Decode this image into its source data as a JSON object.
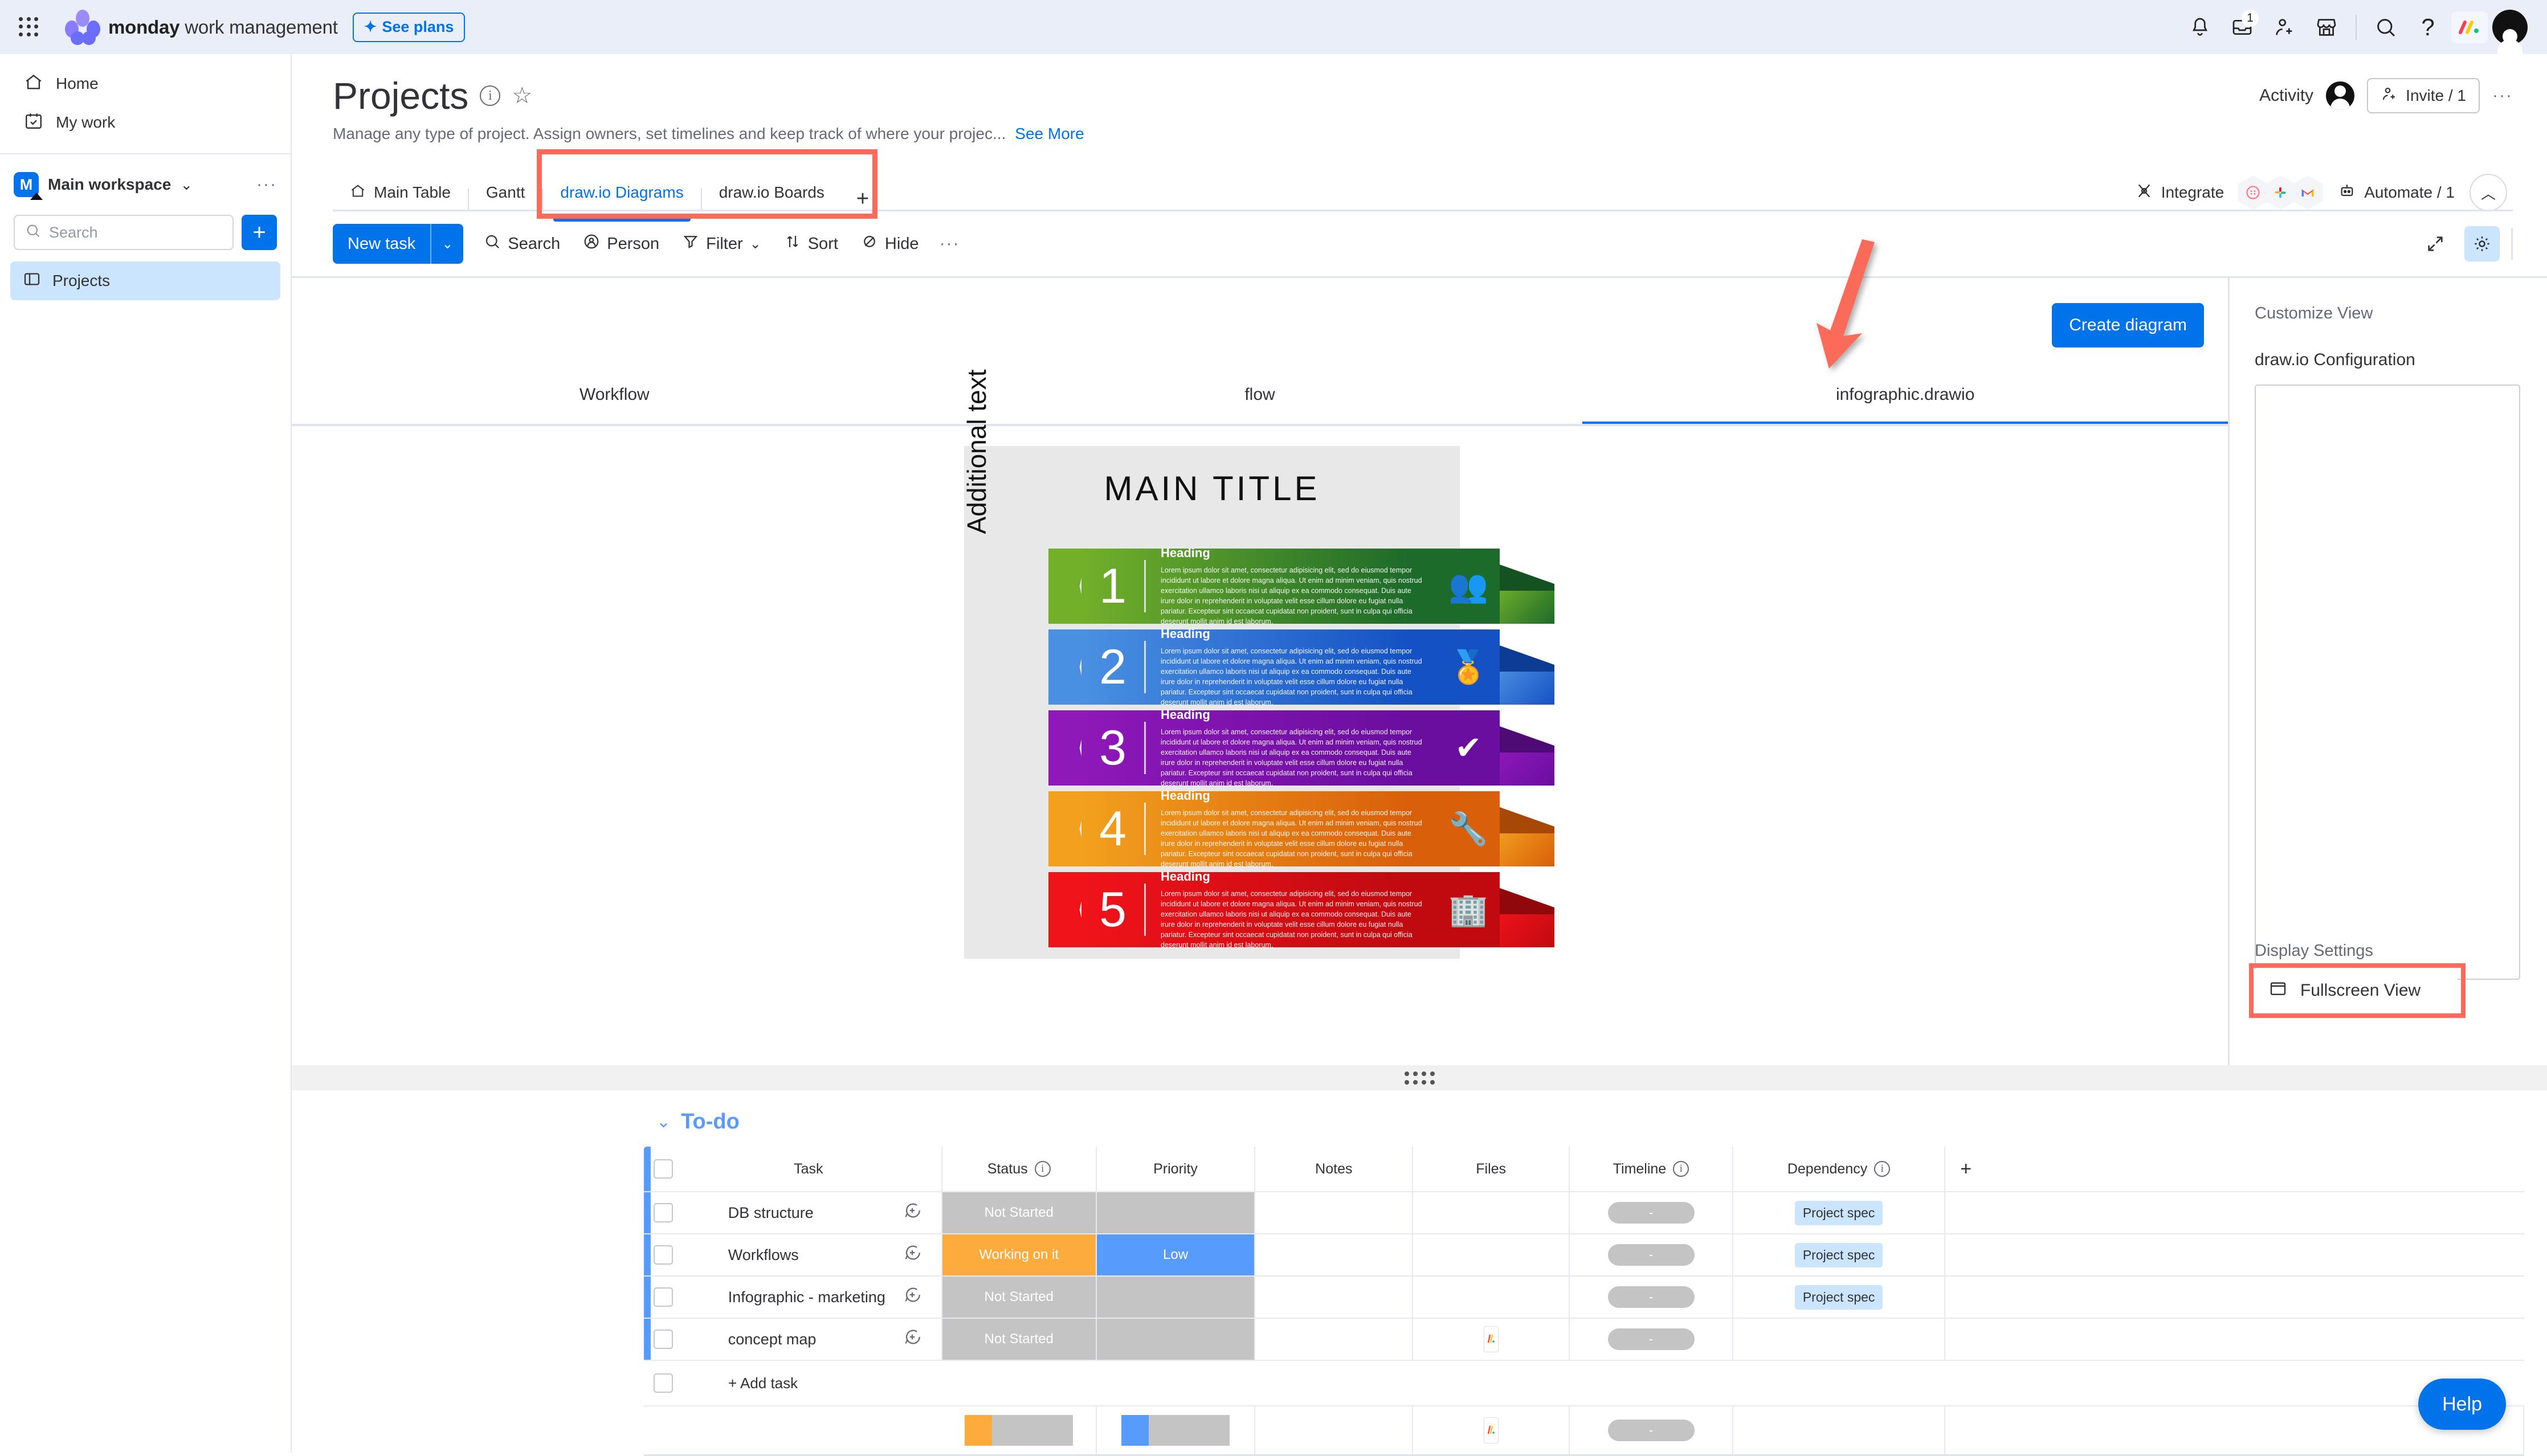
{
  "topbar": {
    "brand_bold": "monday",
    "brand_rest": " work management",
    "see_plans": "See plans",
    "icons": {
      "apps": "apps-grid-icon",
      "notifications": "bell-icon",
      "inbox": "inbox-icon",
      "inbox_badge": "1",
      "invite": "invite-person-icon",
      "marketplace": "marketplace-icon",
      "search": "search-icon",
      "help": "question-mark-icon",
      "monday_badge": "monday-logo-icon",
      "avatar": "user-avatar"
    }
  },
  "sidebar": {
    "nav": [
      {
        "label": "Home",
        "icon": "home-icon"
      },
      {
        "label": "My work",
        "icon": "calendar-check-icon"
      }
    ],
    "workspace": {
      "initial": "M",
      "name": "Main workspace",
      "chevron": "chevron-down-icon",
      "more": "···"
    },
    "search_placeholder": "Search",
    "add_button": "+",
    "boards": [
      {
        "label": "Projects",
        "icon": "board-icon",
        "active": true
      }
    ]
  },
  "board": {
    "title": "Projects",
    "description": "Manage any type of project. Assign owners, set timelines and keep track of where your projec...",
    "see_more": "See More",
    "activity_label": "Activity",
    "invite_label": "Invite / 1",
    "more_label": "···",
    "tabs": [
      {
        "label": "Main Table",
        "icon": "home-icon",
        "active": false
      },
      {
        "label": "Gantt",
        "icon": "",
        "active": false
      },
      {
        "label": "draw.io Diagrams",
        "icon": "",
        "active": true
      },
      {
        "label": "draw.io Boards",
        "icon": "",
        "active": false
      }
    ],
    "tab_add": "+",
    "integrate_label": "Integrate",
    "automate_label": "Automate / 1",
    "integration_icons": [
      "monday-integration-icon",
      "slack-icon",
      "gmail-icon"
    ],
    "collapse_icon": "chevron-up-icon"
  },
  "toolbar": {
    "new_task": "New task",
    "new_task_chevron": "chevron-down-icon",
    "buttons": [
      {
        "label": "Search",
        "icon": "search-icon"
      },
      {
        "label": "Person",
        "icon": "person-icon"
      },
      {
        "label": "Filter",
        "icon": "filter-icon",
        "chevron": "chevron-down-icon"
      },
      {
        "label": "Sort",
        "icon": "sort-icon"
      },
      {
        "label": "Hide",
        "icon": "hide-eye-icon"
      }
    ],
    "more": "···",
    "expand_icon": "expand-arrows-icon",
    "settings_icon": "gear-icon"
  },
  "drawio": {
    "create_diagram": "Create diagram",
    "tabs": [
      {
        "label": "Workflow",
        "active": false
      },
      {
        "label": "flow",
        "active": false
      },
      {
        "label": "infographic.drawio",
        "active": true
      }
    ]
  },
  "infographic": {
    "main_title": "MAIN TITLE",
    "side_text": "Additional text",
    "body_text": "Lorem ipsum dolor sit amet, consectetur adipisicing elit, sed do eiusmod tempor incididunt ut labore et dolore magna aliqua. Ut enim ad minim veniam, quis nostrud exercitation ullamco laboris nisi ut aliquip ex ea commodo consequat. Duis aute irure dolor in reprehenderit in voluptate velit esse cillum dolore eu fugiat nulla pariatur. Excepteur sint occaecat cupidatat non proident, sunt in culpa qui officia deserunt mollit anim id est laborum.",
    "bands": [
      {
        "number": "1",
        "heading": "Heading",
        "icon": "people-group-icon",
        "glyph": "👥",
        "color_light": "#72b02a",
        "color_dark": "#1d6b2a",
        "shadow": "#155221"
      },
      {
        "number": "2",
        "heading": "Heading",
        "icon": "award-ribbon-icon",
        "glyph": "🏅",
        "color_light": "#4a90e2",
        "color_dark": "#1452c4",
        "shadow": "#0d3c94"
      },
      {
        "number": "3",
        "heading": "Heading",
        "icon": "verified-badge-icon",
        "glyph": "✔",
        "color_light": "#8e18b8",
        "color_dark": "#6a0ea0",
        "shadow": "#4e0b76"
      },
      {
        "number": "4",
        "heading": "Heading",
        "icon": "tools-wrench-icon",
        "glyph": "🔧",
        "color_light": "#f2a01e",
        "color_dark": "#d95f0a",
        "shadow": "#a84806"
      },
      {
        "number": "5",
        "heading": "Heading",
        "icon": "city-buildings-icon",
        "glyph": "🏢",
        "color_light": "#f0131a",
        "color_dark": "#c00a10",
        "shadow": "#90070c"
      }
    ]
  },
  "config_panel": {
    "customize_view": "Customize View",
    "drawio_configuration": "draw.io Configuration",
    "config_value": "",
    "display_settings": "Display Settings",
    "fullscreen_view": "Fullscreen View",
    "fullscreen_icon": "window-icon"
  },
  "table": {
    "group_title": "To-do",
    "group_chevron": "chevron-down-icon",
    "columns": [
      {
        "label": "Task",
        "info": false
      },
      {
        "label": "Status",
        "info": true
      },
      {
        "label": "Priority",
        "info": false
      },
      {
        "label": "Notes",
        "info": false
      },
      {
        "label": "Files",
        "info": false
      },
      {
        "label": "Timeline",
        "info": true
      },
      {
        "label": "Dependency",
        "info": true
      }
    ],
    "add_column": "+",
    "rows": [
      {
        "task": "DB structure",
        "status": "Not Started",
        "status_color": "#c4c4c4",
        "priority": "",
        "priority_color": "#c4c4c4",
        "notes": "",
        "files": "",
        "timeline": "-",
        "dependency": "Project spec"
      },
      {
        "task": "Workflows",
        "status": "Working on it",
        "status_color": "#fdab3d",
        "priority": "Low",
        "priority_color": "#579bfc",
        "notes": "",
        "files": "",
        "timeline": "-",
        "dependency": "Project spec"
      },
      {
        "task": "Infographic - marketing",
        "status": "Not Started",
        "status_color": "#c4c4c4",
        "priority": "",
        "priority_color": "#c4c4c4",
        "notes": "",
        "files": "",
        "timeline": "-",
        "dependency": "Project spec"
      },
      {
        "task": "concept map",
        "status": "Not Started",
        "status_color": "#c4c4c4",
        "priority": "",
        "priority_color": "#c4c4c4",
        "notes": "",
        "files": "drawio-file-icon",
        "timeline": "-",
        "dependency": ""
      }
    ],
    "add_task": "+ Add task",
    "summary": {
      "status_segment_color": "#fdab3d",
      "status_segment_pct": 25,
      "priority_segment_color": "#579bfc",
      "priority_segment_pct": 25,
      "timeline": "-",
      "files": "drawio-file-icon"
    }
  },
  "help": {
    "label": "Help"
  },
  "annotations": {
    "tabs_highlight_color": "#fc6a5a",
    "arrow_color": "#fc6a5a",
    "fullscreen_highlight_color": "#fc6a5a"
  }
}
